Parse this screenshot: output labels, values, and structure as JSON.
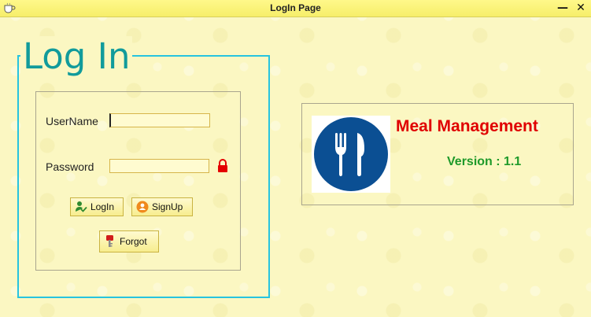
{
  "window": {
    "title": "LogIn Page",
    "minimize_symbol": "—",
    "maximize_symbol": "✕",
    "app_icon": "coffee-cup-icon"
  },
  "login": {
    "heading": "Log In",
    "username_label": "UserName",
    "username_value": "",
    "password_label": "Password",
    "password_value": "",
    "lock_icon": "lock-icon",
    "login_button": "LogIn",
    "signup_button": "SignUp",
    "forgot_button": "Forgot"
  },
  "info": {
    "app_name": "Meal Management",
    "version": "Version : 1.1",
    "logo_icon": "fork-knife-icon"
  },
  "colors": {
    "background": "#fbf7c2",
    "frame_border": "#27c4df",
    "heading": "#119b9b",
    "app_name": "#e00000",
    "version": "#1f9a2a",
    "logo_circle": "#0b4f93"
  }
}
